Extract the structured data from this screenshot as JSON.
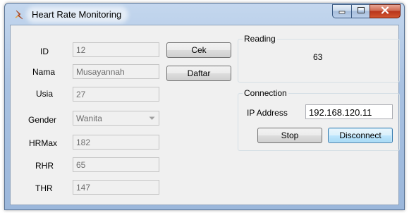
{
  "window": {
    "title": "Heart Rate Monitoring"
  },
  "form": {
    "id": {
      "label": "ID",
      "value": "12"
    },
    "nama": {
      "label": "Nama",
      "value": "Musayannah"
    },
    "usia": {
      "label": "Usia",
      "value": "27"
    },
    "gender": {
      "label": "Gender",
      "value": "Wanita"
    },
    "hrmax": {
      "label": "HRMax",
      "value": "182"
    },
    "rhr": {
      "label": "RHR",
      "value": "65"
    },
    "thr": {
      "label": "THR",
      "value": "147"
    }
  },
  "buttons": {
    "cek": "Cek",
    "daftar": "Daftar",
    "stop": "Stop",
    "disconnect": "Disconnect"
  },
  "reading": {
    "title": "Reading",
    "value": "63"
  },
  "connection": {
    "title": "Connection",
    "ip_label": "IP Address",
    "ip_value": "192.168.120.11"
  },
  "icons": {
    "app": "heart-rate-app-icon",
    "minimize": "minimize-icon",
    "maximize": "maximize-icon",
    "close": "close-icon",
    "dropdown": "chevron-down-icon"
  },
  "colors": {
    "titlebar": "#a9c2e2",
    "close_button": "#c8452a",
    "client_bg": "#f0f0f0",
    "focused_button_border": "#3c7fb1"
  }
}
